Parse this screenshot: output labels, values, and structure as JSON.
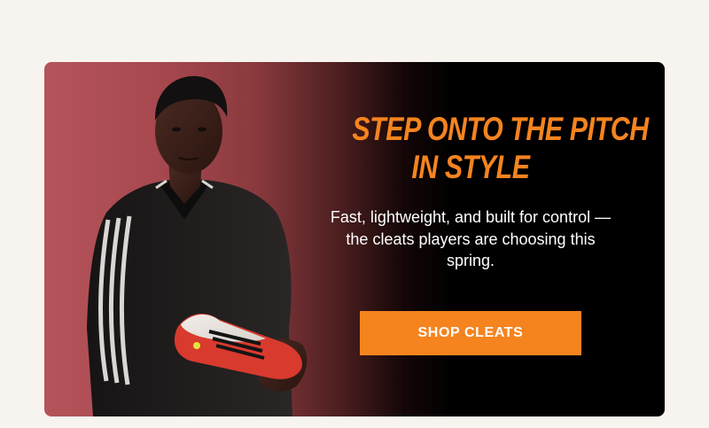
{
  "banner": {
    "headline_line1": "STEP ONTO THE PITCH",
    "headline_line2": "IN STYLE",
    "body": "Fast, lightweight, and built for control — the cleats players are choosing this spring.",
    "cta_label": "SHOP CLEATS",
    "image_subject": "player-holding-cleat"
  },
  "colors": {
    "accent": "#f5841f",
    "page_background": "#f7f4ef",
    "banner_dark": "#000000",
    "banner_red": "#b4545a"
  }
}
